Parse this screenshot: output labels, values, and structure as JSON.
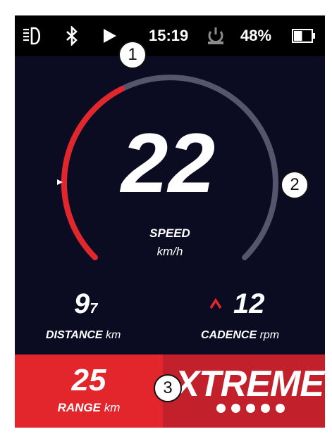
{
  "status_bar": {
    "headlight_icon": "headlight-icon",
    "bluetooth_icon": "bluetooth-icon",
    "navigation_icon": "play-icon",
    "time": "15:19",
    "power_icon": "power-plug-icon",
    "battery_percent": "48%",
    "battery_level": 0.48
  },
  "gauge": {
    "speed": "22",
    "speed_label": "SPEED",
    "speed_unit": "km/h",
    "arc_fraction": 0.4,
    "active_color": "#e3262c",
    "track_color": "#55566e"
  },
  "metrics": {
    "distance": {
      "value_main": "9",
      "value_decimal": "7",
      "label": "DISTANCE",
      "unit": "km"
    },
    "cadence": {
      "arrow_icon": "chevron-up-icon",
      "value": "12",
      "label": "CADENCE",
      "unit": "rpm"
    }
  },
  "bottom": {
    "range": {
      "value": "25",
      "label": "RANGE",
      "unit": "km"
    },
    "mode": {
      "name": "XTREME",
      "level_dots": 5
    }
  },
  "callouts": [
    "1",
    "2",
    "3"
  ],
  "colors": {
    "panel_red": "#e3262c",
    "panel_dark_red": "#c2202a",
    "background": "#0b0c22"
  }
}
